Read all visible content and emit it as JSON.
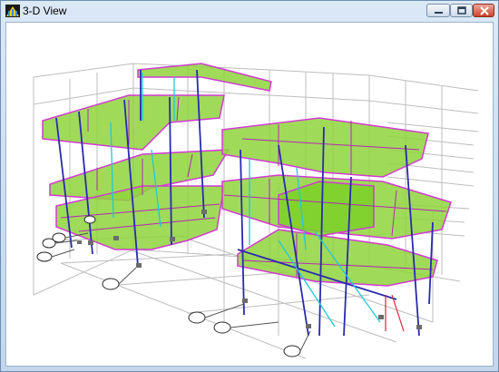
{
  "window": {
    "title": "3-D View",
    "icon": "structure-app-icon",
    "controls": [
      "minimize-icon",
      "maximize-icon",
      "close-icon"
    ]
  },
  "view": {
    "background": "#ffffff",
    "slab_color": "#8fd43c",
    "slab_edge_color": "#d23ad2",
    "column_color": "#2a2ab0",
    "brace_color": "#22c8d8",
    "grid_color": "#b4b4b4"
  }
}
